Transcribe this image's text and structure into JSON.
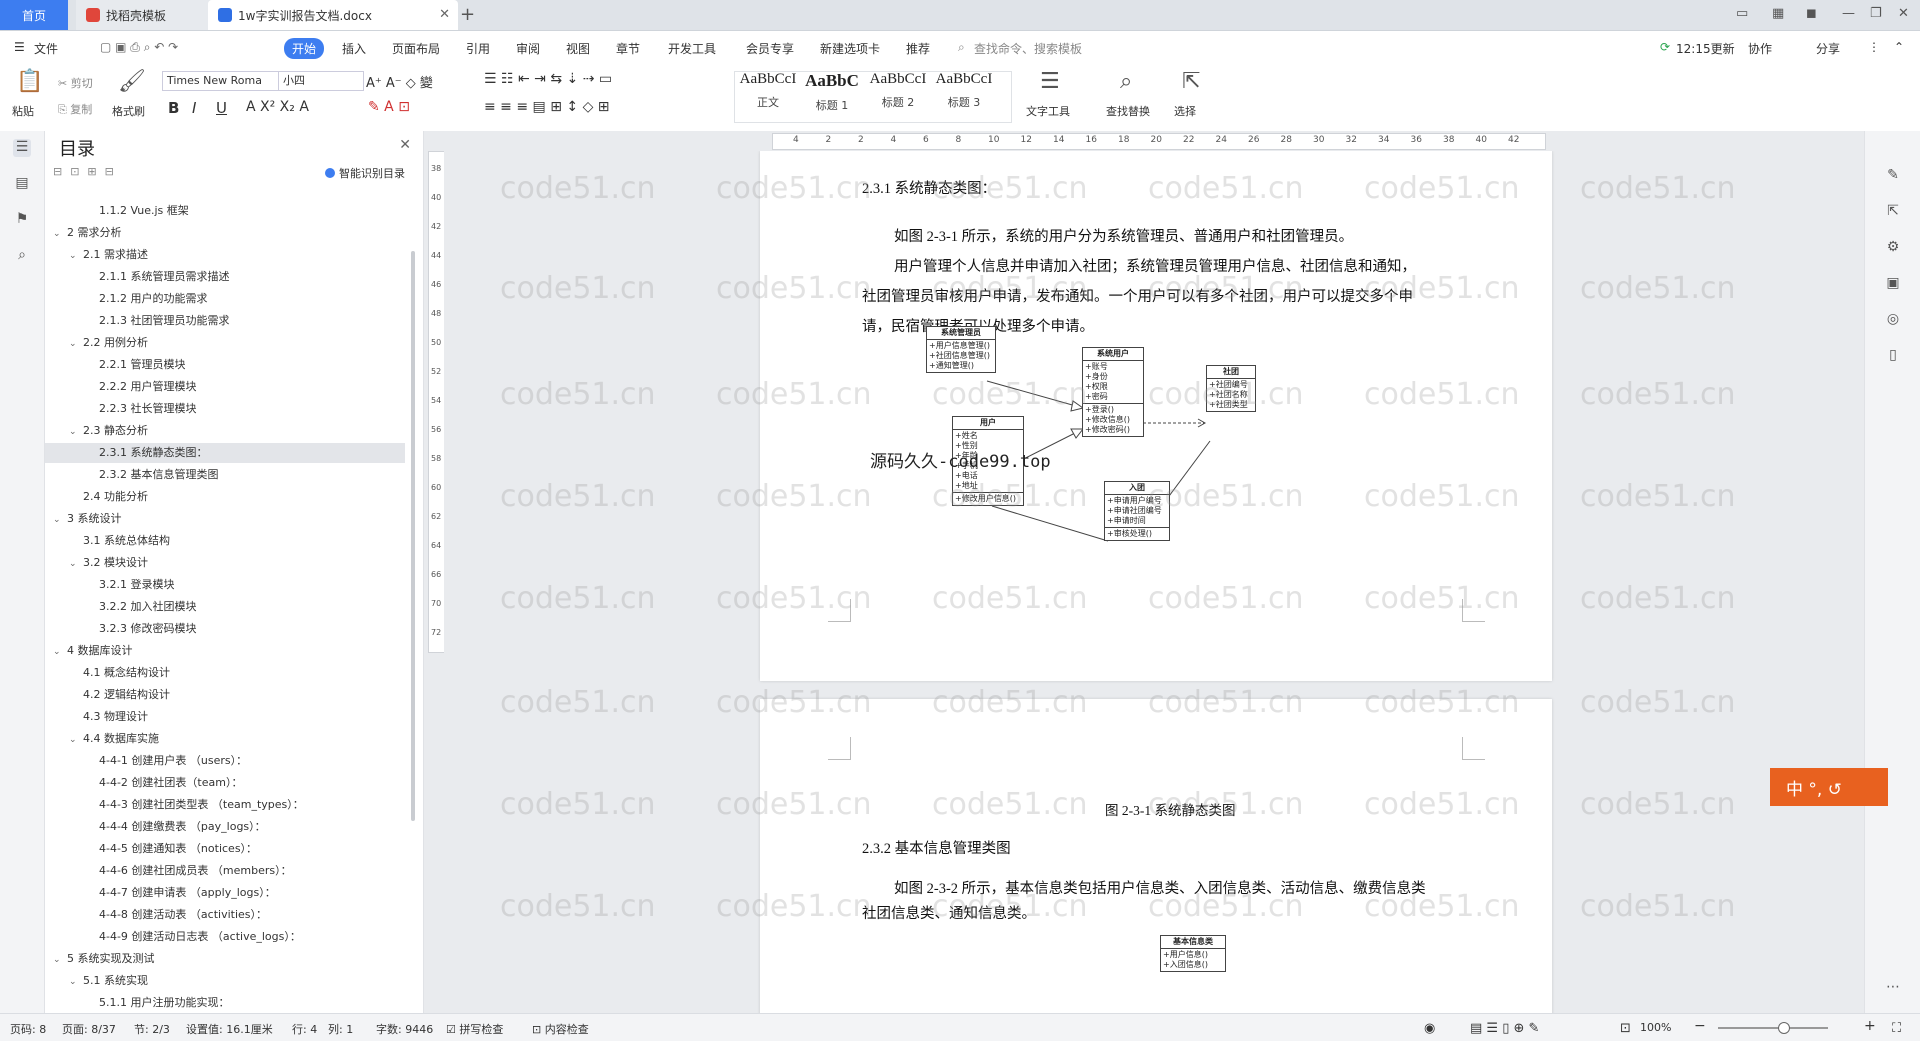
{
  "tabs": {
    "home": "首页",
    "template": "找稻壳模板",
    "document": "1w字实训报告文档.docx"
  },
  "menu": {
    "file": "文件",
    "items": [
      "开始",
      "插入",
      "页面布局",
      "引用",
      "审阅",
      "视图",
      "章节",
      "开发工具",
      "会员专享",
      "新建选项卡",
      "推荐"
    ],
    "search_placeholder": "查找命令、搜索模板",
    "update": "12:15更新",
    "collab": "协作",
    "share": "分享"
  },
  "toolbar": {
    "paste": "粘贴",
    "cut": "剪切",
    "copy": "复制",
    "format_painter": "格式刷",
    "font_name": "Times New Roma",
    "font_size": "小四",
    "styles": [
      {
        "sample": "AaBbCcI",
        "label": "正文"
      },
      {
        "sample": "AaBbC",
        "label": "标题 1"
      },
      {
        "sample": "AaBbCcI",
        "label": "标题 2"
      },
      {
        "sample": "AaBbCcI",
        "label": "标题 3"
      }
    ],
    "text_tools": "文字工具",
    "find_replace": "查找替换",
    "select": "选择"
  },
  "toc": {
    "title": "目录",
    "smart": "智能识别目录",
    "items": [
      {
        "level": 3,
        "text": "1.1.2 Vue.js 框架",
        "arrow": ""
      },
      {
        "level": 1,
        "text": "2 需求分析",
        "arrow": "v"
      },
      {
        "level": 2,
        "text": "2.1 需求描述",
        "arrow": "v"
      },
      {
        "level": 3,
        "text": "2.1.1 系统管理员需求描述",
        "arrow": ""
      },
      {
        "level": 3,
        "text": "2.1.2 用户的功能需求",
        "arrow": ""
      },
      {
        "level": 3,
        "text": "2.1.3 社团管理员功能需求",
        "arrow": ""
      },
      {
        "level": 2,
        "text": "2.2 用例分析",
        "arrow": "v"
      },
      {
        "level": 3,
        "text": "2.2.1 管理员模块",
        "arrow": ""
      },
      {
        "level": 3,
        "text": "2.2.2 用户管理模块",
        "arrow": ""
      },
      {
        "level": 3,
        "text": "2.2.3 社长管理模块",
        "arrow": ""
      },
      {
        "level": 2,
        "text": "2.3 静态分析",
        "arrow": "v"
      },
      {
        "level": 3,
        "text": "2.3.1 系统静态类图：",
        "arrow": "",
        "selected": true
      },
      {
        "level": 3,
        "text": "2.3.2 基本信息管理类图",
        "arrow": ""
      },
      {
        "level": 2,
        "text": "2.4 功能分析",
        "arrow": ""
      },
      {
        "level": 1,
        "text": "3 系统设计",
        "arrow": "v"
      },
      {
        "level": 2,
        "text": "3.1 系统总体结构",
        "arrow": ""
      },
      {
        "level": 2,
        "text": "3.2 模块设计",
        "arrow": "v"
      },
      {
        "level": 3,
        "text": "3.2.1 登录模块",
        "arrow": ""
      },
      {
        "level": 3,
        "text": "3.2.2 加入社团模块",
        "arrow": ""
      },
      {
        "level": 3,
        "text": "3.2.3 修改密码模块",
        "arrow": ""
      },
      {
        "level": 1,
        "text": "4 数据库设计",
        "arrow": "v"
      },
      {
        "level": 2,
        "text": "4.1 概念结构设计",
        "arrow": ""
      },
      {
        "level": 2,
        "text": "4.2 逻辑结构设计",
        "arrow": ""
      },
      {
        "level": 2,
        "text": "4.3 物理设计",
        "arrow": ""
      },
      {
        "level": 2,
        "text": "4.4 数据库实施",
        "arrow": "v"
      },
      {
        "level": 3,
        "text": "4-4-1 创建用户表 （users）：",
        "arrow": ""
      },
      {
        "level": 3,
        "text": "4-4-2 创建社团表（team）：",
        "arrow": ""
      },
      {
        "level": 3,
        "text": "4-4-3 创建社团类型表 （team_types）：",
        "arrow": ""
      },
      {
        "level": 3,
        "text": "4-4-4 创建缴费表 （pay_logs）：",
        "arrow": ""
      },
      {
        "level": 3,
        "text": "4-4-5 创建通知表 （notices）：",
        "arrow": ""
      },
      {
        "level": 3,
        "text": "4-4-6 创建社团成员表 （members）：",
        "arrow": ""
      },
      {
        "level": 3,
        "text": "4-4-7 创建申请表 （apply_logs）：",
        "arrow": ""
      },
      {
        "level": 3,
        "text": "4-4-8 创建活动表 （activities）：",
        "arrow": ""
      },
      {
        "level": 3,
        "text": "4-4-9 创建活动日志表 （active_logs）：",
        "arrow": ""
      },
      {
        "level": 1,
        "text": "5 系统实现及测试",
        "arrow": "v"
      },
      {
        "level": 2,
        "text": "5.1 系统实现",
        "arrow": "v"
      },
      {
        "level": 3,
        "text": "5.1.1 用户注册功能实现：",
        "arrow": ""
      }
    ]
  },
  "ruler": {
    "h_ticks": [
      "4",
      "2",
      "2",
      "4",
      "6",
      "8",
      "10",
      "12",
      "14",
      "16",
      "18",
      "20",
      "22",
      "24",
      "26",
      "28",
      "30",
      "32",
      "34",
      "36",
      "38",
      "40",
      "42"
    ],
    "v_ticks": [
      "38",
      "40",
      "42",
      "44",
      "46",
      "48",
      "50",
      "52",
      "54",
      "56",
      "58",
      "60",
      "62",
      "64",
      "66",
      "70",
      "72"
    ]
  },
  "document": {
    "heading_231": "2.3.1 系统静态类图：",
    "para1": "如图 2-3-1 所示，系统的用户分为系统管理员、普通用户和社团管理员。",
    "para2_line1": "用户管理个人信息并申请加入社团；系统管理员管理用户信息、社团信息和通知，",
    "para2_line2": "社团管理员审核用户申请，发布通知。一个用户可以有多个社团，用户可以提交多个申",
    "para2_line3": "请，民宿管理者可以处理多个申请。",
    "code_watermark": "源码久久-code99.top",
    "figure_caption": "图 2-3-1 系统静态类图",
    "heading_232": "2.3.2 基本信息管理类图",
    "para3_line1": "如图 2-3-2 所示，基本信息类包括用户信息类、入团信息类、活动信息、缴费信息类",
    "para3_line2": "社团信息类、通知信息类。",
    "uml": {
      "admin": {
        "title": "系统管理员",
        "items": [
          "+用户信息管理()",
          "+社团信息管理()",
          "+通知管理()"
        ]
      },
      "sysuser": {
        "title": "系统用户",
        "items": [
          "+账号",
          "+身份",
          "+权限",
          "+密码"
        ],
        "methods": [
          "+登录()",
          "+修改信息()",
          "+修改密码()"
        ]
      },
      "team": {
        "title": "社团",
        "items": [
          "+社团编号",
          "+社团名称",
          "+社团类型"
        ]
      },
      "user": {
        "title": "用户",
        "items": [
          "+姓名",
          "+性别",
          "+年龄",
          "+手机",
          "+电话",
          "+地址"
        ],
        "methods": [
          "+修改用户信息()"
        ]
      },
      "join": {
        "title": "入团",
        "items": [
          "+申请用户编号",
          "+申请社团编号",
          "+申请时间"
        ],
        "methods": [
          "+审核处理()"
        ]
      },
      "baseinfo": {
        "title": "基本信息类",
        "items": [
          "+用户信息()",
          "+入团信息()"
        ]
      }
    }
  },
  "watermark_text": "code51.cn",
  "ime": "中 °, ↺",
  "status": {
    "page_num": "页码: 8",
    "page": "页面: 8/37",
    "section": "节: 2/3",
    "setting": "设置值: 16.1厘米",
    "row": "行: 4",
    "col": "列: 1",
    "words": "字数: 9446",
    "spell": "拼写检查",
    "content_check": "内容检查",
    "zoom": "100%"
  }
}
